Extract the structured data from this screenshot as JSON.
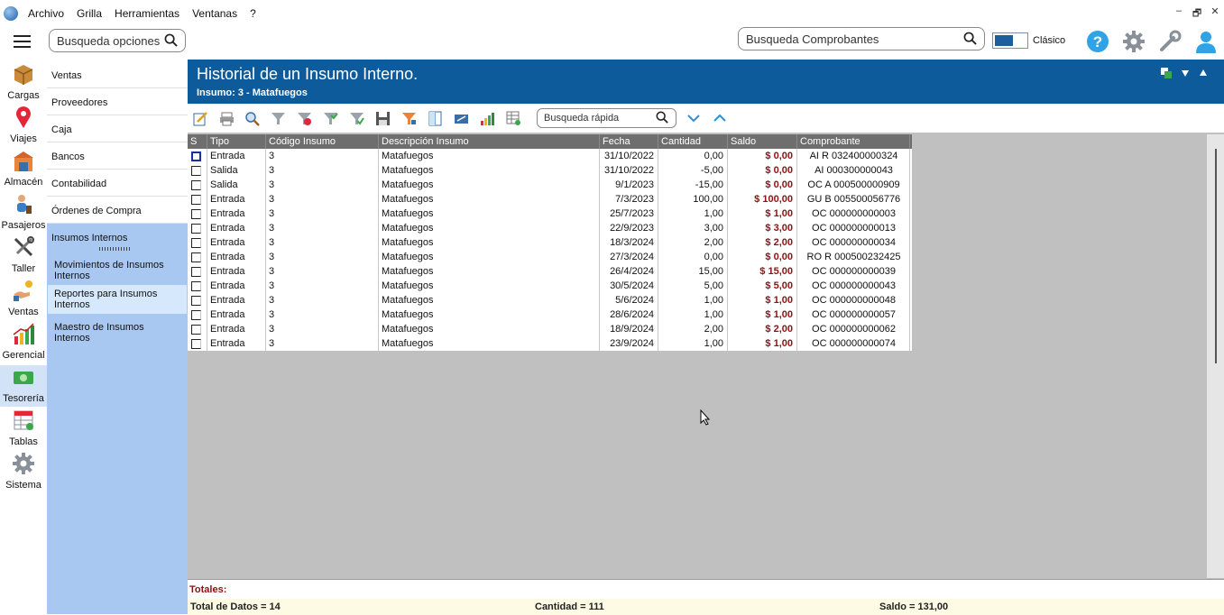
{
  "menubar": {
    "items": [
      "Archivo",
      "Grilla",
      "Herramientas",
      "Ventanas",
      "?"
    ],
    "window_controls": [
      "–",
      "🗗",
      "✕"
    ]
  },
  "topbar": {
    "search_options_placeholder": "Busqueda opciones",
    "search_vouchers_placeholder": "Busqueda Comprobantes",
    "mode_label": "Clásico",
    "icons": [
      "help-icon",
      "gear-icon",
      "wrench-icon",
      "user-icon"
    ]
  },
  "sidebar": {
    "items": [
      {
        "label": "Cargas",
        "icon": "box-icon"
      },
      {
        "label": "Viajes",
        "icon": "map-pin-icon"
      },
      {
        "label": "Almacén",
        "icon": "warehouse-icon"
      },
      {
        "label": "Pasajeros",
        "icon": "passenger-icon"
      },
      {
        "label": "Taller",
        "icon": "tools-icon"
      },
      {
        "label": "Ventas",
        "icon": "sales-icon"
      },
      {
        "label": "Gerencial",
        "icon": "bar-chart-icon"
      },
      {
        "label": "Tesorería",
        "icon": "money-icon"
      },
      {
        "label": "Tablas",
        "icon": "table-icon"
      },
      {
        "label": "Sistema",
        "icon": "system-gear-icon"
      }
    ],
    "active": "Tesorería"
  },
  "leftmenu": {
    "items": [
      "Ventas",
      "Proveedores",
      "Caja",
      "Bancos",
      "Contabilidad",
      "Órdenes de Compra",
      "Insumos Internos"
    ],
    "selected": "Insumos Internos",
    "subitems": [
      "Movimientos de Insumos Internos",
      "Reportes para Insumos Internos",
      "Maestro de Insumos Internos"
    ]
  },
  "header": {
    "title": "Historial de un Insumo Interno.",
    "subtitle": "Insumo: 3 - Matafuegos"
  },
  "toolbar": {
    "quick_search_placeholder": "Busqueda rápida"
  },
  "grid": {
    "columns": [
      "S",
      "Tipo",
      "Código Insumo",
      "Descripción Insumo",
      "Fecha",
      "Cantidad",
      "Saldo",
      "Comprobante"
    ],
    "rows": [
      {
        "tipo": "Entrada",
        "codigo": "3",
        "descripcion": "Matafuegos",
        "fecha": "31/10/2022",
        "cantidad": "0,00",
        "saldo": "$ 0,00",
        "comprobante": "AI R 032400000324"
      },
      {
        "tipo": "Salida",
        "codigo": "3",
        "descripcion": "Matafuegos",
        "fecha": "31/10/2022",
        "cantidad": "-5,00",
        "saldo": "$ 0,00",
        "comprobante": "AI  000300000043"
      },
      {
        "tipo": "Salida",
        "codigo": "3",
        "descripcion": "Matafuegos",
        "fecha": "9/1/2023",
        "cantidad": "-15,00",
        "saldo": "$ 0,00",
        "comprobante": "OC A 000500000909"
      },
      {
        "tipo": "Entrada",
        "codigo": "3",
        "descripcion": "Matafuegos",
        "fecha": "7/3/2023",
        "cantidad": "100,00",
        "saldo": "$ 100,00",
        "comprobante": "GU B 005500056776"
      },
      {
        "tipo": "Entrada",
        "codigo": "3",
        "descripcion": "Matafuegos",
        "fecha": "25/7/2023",
        "cantidad": "1,00",
        "saldo": "$ 1,00",
        "comprobante": "OC  000000000003"
      },
      {
        "tipo": "Entrada",
        "codigo": "3",
        "descripcion": "Matafuegos",
        "fecha": "22/9/2023",
        "cantidad": "3,00",
        "saldo": "$ 3,00",
        "comprobante": "OC  000000000013"
      },
      {
        "tipo": "Entrada",
        "codigo": "3",
        "descripcion": "Matafuegos",
        "fecha": "18/3/2024",
        "cantidad": "2,00",
        "saldo": "$ 2,00",
        "comprobante": "OC  000000000034"
      },
      {
        "tipo": "Entrada",
        "codigo": "3",
        "descripcion": "Matafuegos",
        "fecha": "27/3/2024",
        "cantidad": "0,00",
        "saldo": "$ 0,00",
        "comprobante": "RO R 000500232425"
      },
      {
        "tipo": "Entrada",
        "codigo": "3",
        "descripcion": "Matafuegos",
        "fecha": "26/4/2024",
        "cantidad": "15,00",
        "saldo": "$ 15,00",
        "comprobante": "OC  000000000039"
      },
      {
        "tipo": "Entrada",
        "codigo": "3",
        "descripcion": "Matafuegos",
        "fecha": "30/5/2024",
        "cantidad": "5,00",
        "saldo": "$ 5,00",
        "comprobante": "OC  000000000043"
      },
      {
        "tipo": "Entrada",
        "codigo": "3",
        "descripcion": "Matafuegos",
        "fecha": "5/6/2024",
        "cantidad": "1,00",
        "saldo": "$ 1,00",
        "comprobante": "OC  000000000048"
      },
      {
        "tipo": "Entrada",
        "codigo": "3",
        "descripcion": "Matafuegos",
        "fecha": "28/6/2024",
        "cantidad": "1,00",
        "saldo": "$ 1,00",
        "comprobante": "OC  000000000057"
      },
      {
        "tipo": "Entrada",
        "codigo": "3",
        "descripcion": "Matafuegos",
        "fecha": "18/9/2024",
        "cantidad": "2,00",
        "saldo": "$ 2,00",
        "comprobante": "OC  000000000062"
      },
      {
        "tipo": "Entrada",
        "codigo": "3",
        "descripcion": "Matafuegos",
        "fecha": "23/9/2024",
        "cantidad": "1,00",
        "saldo": "$ 1,00",
        "comprobante": "OC  000000000074"
      }
    ]
  },
  "totals": {
    "label": "Totales:",
    "total_datos": "Total de Datos = 14",
    "cantidad": "Cantidad = 111",
    "saldo": "Saldo = 131,00"
  },
  "colors": {
    "header_blue": "#0d5b9a",
    "menu_blue": "#a9c8f1",
    "saldo_red": "#8e1010",
    "grid_header": "#6e6e6e"
  }
}
